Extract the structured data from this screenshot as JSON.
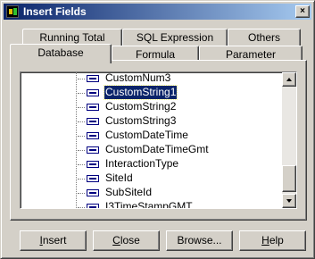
{
  "window": {
    "title": "Insert Fields",
    "close_glyph": "×"
  },
  "tabs_back": [
    "Running Total",
    "SQL Expression",
    "Others"
  ],
  "tabs_front": [
    "Database",
    "Formula",
    "Parameter"
  ],
  "active_tab": "Database",
  "fields": [
    "CustomNum3",
    "CustomString1",
    "CustomString2",
    "CustomString3",
    "CustomDateTime",
    "CustomDateTimeGmt",
    "InteractionType",
    "SiteId",
    "SubSiteId",
    "I3TimeStampGMT"
  ],
  "selected_field": "CustomString1",
  "buttons": {
    "insert": {
      "mn": "I",
      "rest": "nsert"
    },
    "close": {
      "mn": "C",
      "rest": "lose"
    },
    "browse": {
      "label": "Browse..."
    },
    "help": {
      "mn": "H",
      "rest": "elp"
    }
  }
}
